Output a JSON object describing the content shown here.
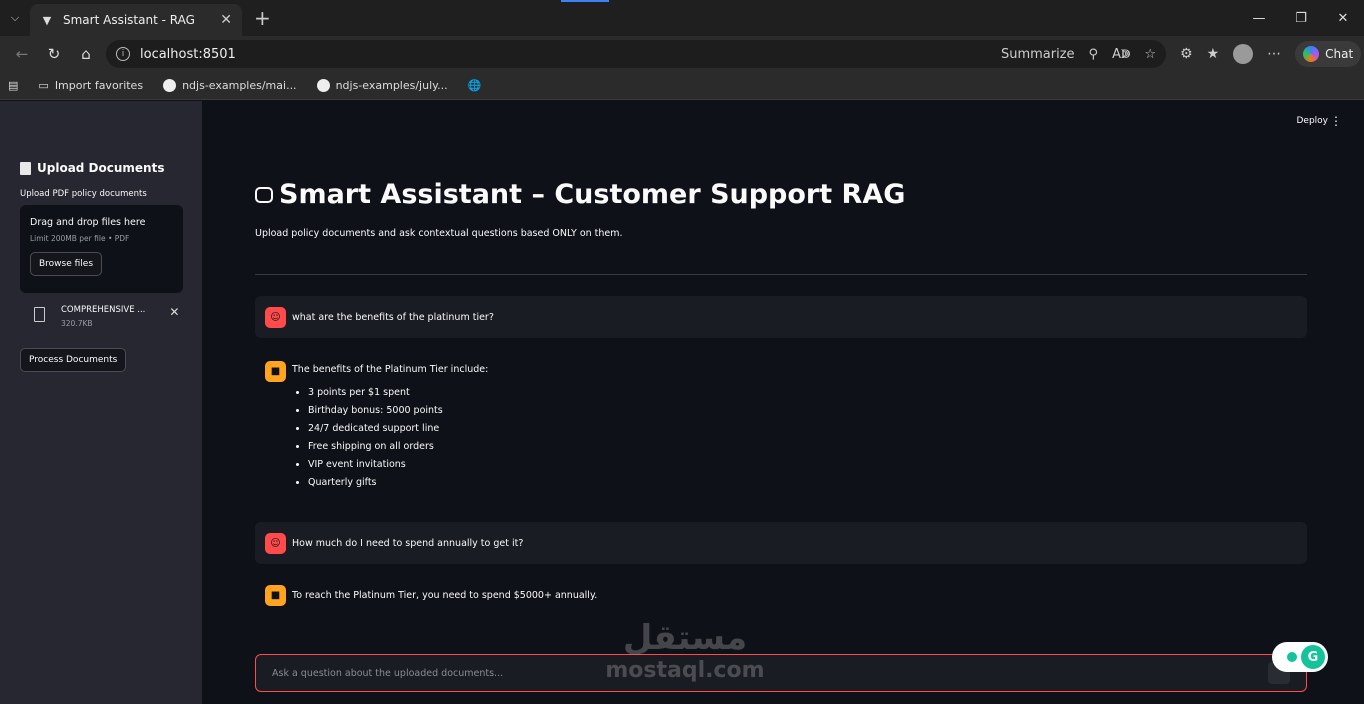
{
  "browser": {
    "tab_title": "Smart Assistant - RAG",
    "url": "localhost:8501",
    "summarize_label": "Summarize",
    "chat_label": "Chat",
    "favorites": [
      "Import favorites",
      "ndjs-examples/mai...",
      "ndjs-examples/july..."
    ]
  },
  "sidebar": {
    "title": "Upload Documents",
    "uploader_label": "Upload PDF policy documents",
    "dropzone_title": "Drag and drop files here",
    "dropzone_hint": "Limit 200MB per file • PDF",
    "browse_label": "Browse files",
    "file_name": "COMPREHENSIVE ...",
    "file_size": "320.7KB",
    "process_label": "Process Documents"
  },
  "header": {
    "deploy_label": "Deploy"
  },
  "main": {
    "title": "Smart Assistant – Customer Support RAG",
    "subtitle": "Upload policy documents and ask contextual questions based ONLY on them."
  },
  "chat": {
    "q1": "what are the benefits of the platinum tier?",
    "a1_intro": "The benefits of the Platinum Tier include:",
    "a1_items": [
      "3 points per $1 spent",
      "Birthday bonus: 5000 points",
      "24/7 dedicated support line",
      "Free shipping on all orders",
      "VIP event invitations",
      "Quarterly gifts"
    ],
    "q2": "How much do I need to spend annually to get it?",
    "a2": "To reach the Platinum Tier, you need to spend $5000+ annually.",
    "input_placeholder": "Ask a question about the uploaded documents..."
  },
  "watermark": {
    "arabic": "مستقل",
    "latin": "mostaql.com"
  },
  "colors": {
    "accent": "#ff4b4b",
    "assistant_avatar": "#ffa421",
    "background": "#0e1117",
    "sidebar": "#262730"
  }
}
